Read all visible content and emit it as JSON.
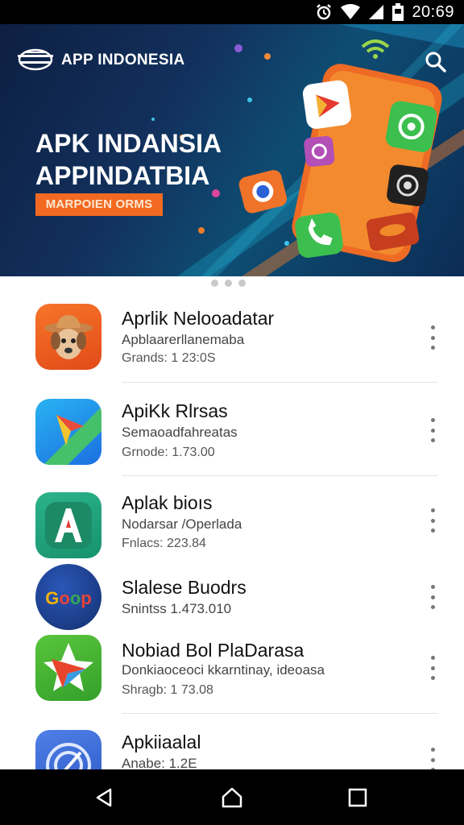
{
  "status_bar": {
    "time": "20:69",
    "icons": [
      "alarm-icon",
      "wifi-icon",
      "signal-icon",
      "battery-icon"
    ]
  },
  "hero": {
    "brand": "APP INDONESIA",
    "headline_1": "APK INDANSIA",
    "headline_2": "APPINDATBIA",
    "badge": "MARPOIEN ORMS",
    "colors": {
      "background": "#12305c",
      "accent": "#f26a21"
    }
  },
  "carousel": {
    "pages": 3
  },
  "apps": [
    {
      "title": "Aprlik Nelooadatar",
      "subtitle": "Apblaarerllanemaba",
      "meta": "Grands: 1 23:0S",
      "icon": "cowboy-dog-icon"
    },
    {
      "title": "ApiKk Rlrsas",
      "subtitle": "Semaoadfahreatas",
      "meta": "Grnode: 1.73.00",
      "icon": "maps-arrow-icon"
    },
    {
      "title": "Aplak bioıs",
      "subtitle": "Nodarsar /Operlada",
      "meta": "Fnlacs: 223.84",
      "icon": "letter-a-icon"
    },
    {
      "title": "Slalese Buodrs",
      "subtitle": "Snintss 1.473.010",
      "meta": "",
      "icon": "goop-logo-icon"
    },
    {
      "title": "Nobiad Bol PlaDarasa",
      "subtitle": "Donkiaoceoci kkarntinay, ideoasa",
      "meta": "Shragb: 1 73.08",
      "icon": "star-plane-icon"
    },
    {
      "title": "Apkiiaalal",
      "subtitle": "Anabe: 1.2E",
      "meta": "",
      "icon": "compass-icon"
    }
  ],
  "nav": {
    "back": "back-icon",
    "home": "home-icon",
    "recents": "recents-icon"
  }
}
